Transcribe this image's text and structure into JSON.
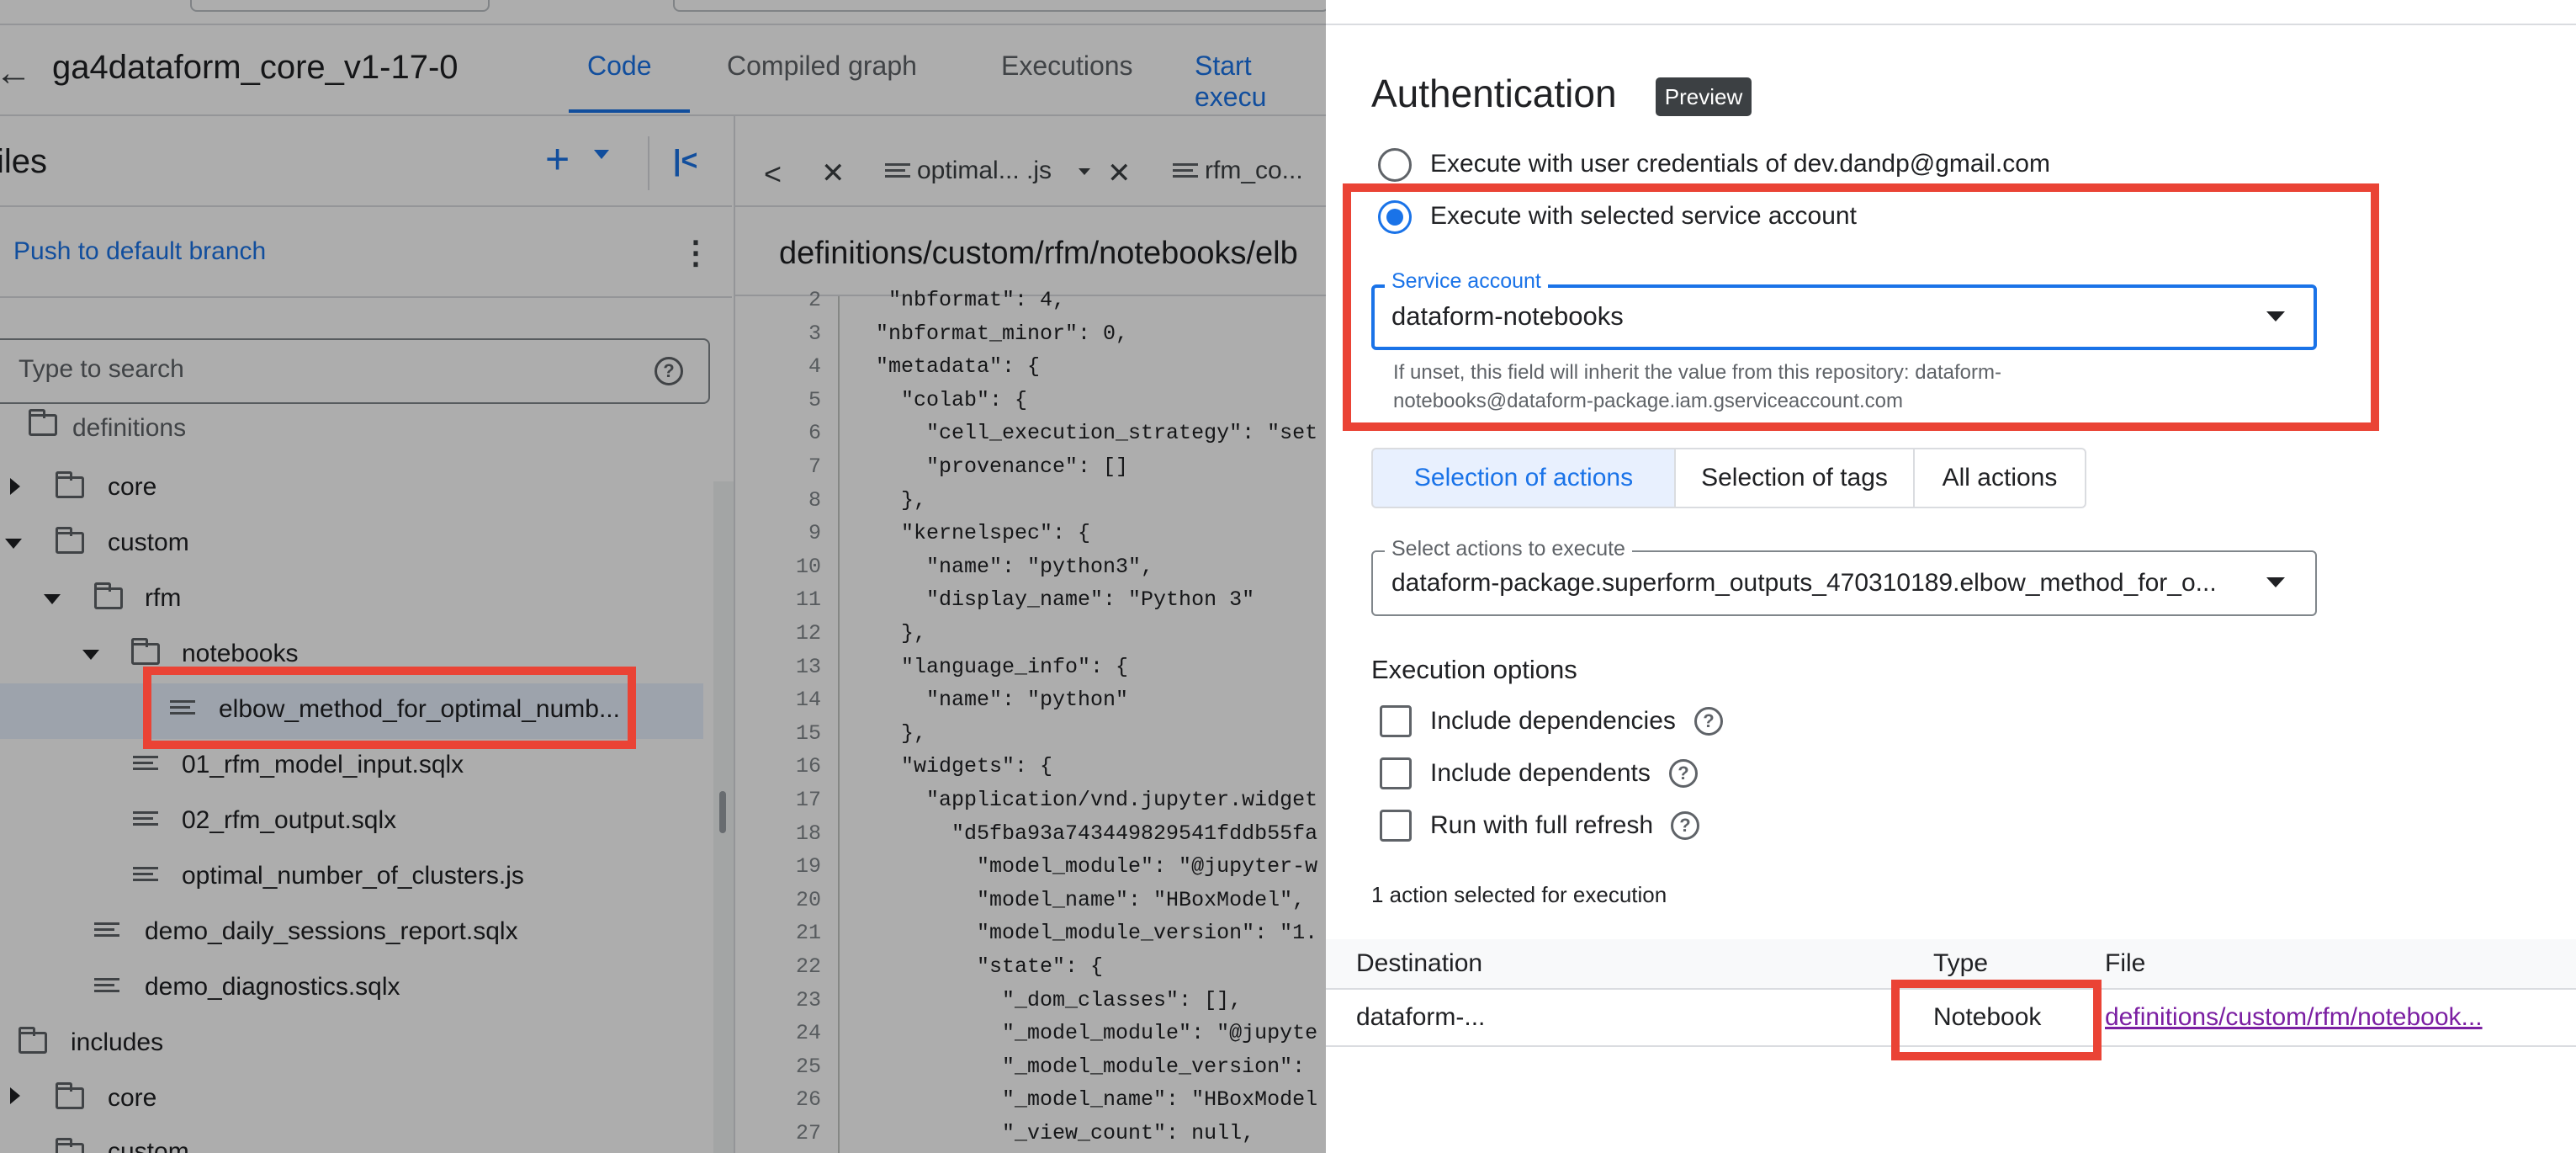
{
  "ide": {
    "workspace_title": "ga4dataform_core_v1-17-0",
    "tabs": [
      {
        "label": "Code",
        "active": true
      },
      {
        "label": "Compiled graph",
        "active": false
      },
      {
        "label": "Executions",
        "active": false
      },
      {
        "label": "Start execu",
        "active": false
      }
    ],
    "files_title": "iles",
    "push_label": "Push to default branch",
    "search_placeholder": "Type to search",
    "tree": [
      {
        "label": "definitions",
        "type": "folder"
      },
      {
        "label": "core",
        "type": "folder",
        "expanded": false
      },
      {
        "label": "custom",
        "type": "folder",
        "expanded": true
      },
      {
        "label": "rfm",
        "type": "folder",
        "expanded": true
      },
      {
        "label": "notebooks",
        "type": "folder",
        "expanded": true
      },
      {
        "label": "elbow_method_for_optimal_numb...",
        "type": "file",
        "selected": true
      },
      {
        "label": "01_rfm_model_input.sqlx",
        "type": "file"
      },
      {
        "label": "02_rfm_output.sqlx",
        "type": "file"
      },
      {
        "label": "optimal_number_of_clusters.js",
        "type": "file"
      },
      {
        "label": "demo_daily_sessions_report.sqlx",
        "type": "file"
      },
      {
        "label": "demo_diagnostics.sqlx",
        "type": "file"
      },
      {
        "label": "includes",
        "type": "folder"
      },
      {
        "label": "core",
        "type": "folder",
        "expanded": false
      },
      {
        "label": "custom",
        "type": "folder"
      }
    ],
    "editor_tabs": [
      {
        "label": "optimal... .js"
      },
      {
        "label": "rfm_co..."
      }
    ],
    "editor_path": "definitions/custom/rfm/notebooks/elb",
    "code_lines": [
      {
        "n": "2",
        "text": "  \"nbformat\": 4,"
      },
      {
        "n": "3",
        "text": " \"nbformat_minor\": 0,"
      },
      {
        "n": "4",
        "text": " \"metadata\": {"
      },
      {
        "n": "5",
        "text": "   \"colab\": {"
      },
      {
        "n": "6",
        "text": "     \"cell_execution_strategy\": \"set"
      },
      {
        "n": "7",
        "text": "     \"provenance\": []"
      },
      {
        "n": "8",
        "text": "   },"
      },
      {
        "n": "9",
        "text": "   \"kernelspec\": {"
      },
      {
        "n": "10",
        "text": "     \"name\": \"python3\","
      },
      {
        "n": "11",
        "text": "     \"display_name\": \"Python 3\""
      },
      {
        "n": "12",
        "text": "   },"
      },
      {
        "n": "13",
        "text": "   \"language_info\": {"
      },
      {
        "n": "14",
        "text": "     \"name\": \"python\""
      },
      {
        "n": "15",
        "text": "   },"
      },
      {
        "n": "16",
        "text": "   \"widgets\": {"
      },
      {
        "n": "17",
        "text": "     \"application/vnd.jupyter.widget"
      },
      {
        "n": "18",
        "text": "       \"d5fba93a743449829541fddb55fa"
      },
      {
        "n": "19",
        "text": "         \"model_module\": \"@jupyter-w"
      },
      {
        "n": "20",
        "text": "         \"model_name\": \"HBoxModel\","
      },
      {
        "n": "21",
        "text": "         \"model_module_version\": \"1."
      },
      {
        "n": "22",
        "text": "         \"state\": {"
      },
      {
        "n": "23",
        "text": "           \"_dom_classes\": [],"
      },
      {
        "n": "24",
        "text": "           \"_model_module\": \"@jupyte"
      },
      {
        "n": "25",
        "text": "           \"_model_module_version\":"
      },
      {
        "n": "26",
        "text": "           \"_model_name\": \"HBoxModel"
      },
      {
        "n": "27",
        "text": "           \"_view_count\": null,"
      }
    ]
  },
  "panel": {
    "title": "Authentication",
    "badge": "Preview",
    "radio_user": "Execute with user credentials of dev.dandp@gmail.com",
    "radio_service": "Execute with selected service account",
    "service_account_label": "Service account",
    "service_account_value": "dataform-notebooks",
    "service_account_hint": "If unset, this field will inherit the value from this repository: dataform-notebooks@dataform-package.iam.gserviceaccount.com",
    "segments": [
      {
        "label": "Selection of actions",
        "active": true
      },
      {
        "label": "Selection of tags",
        "active": false
      },
      {
        "label": "All actions",
        "active": false
      }
    ],
    "select_actions_label": "Select actions to execute",
    "select_actions_value": "dataform-package.superform_outputs_470310189.elbow_method_for_o...",
    "execution_options_title": "Execution options",
    "options": [
      {
        "label": "Include dependencies",
        "checked": false
      },
      {
        "label": "Include dependents",
        "checked": false
      },
      {
        "label": "Run with full refresh",
        "checked": false
      }
    ],
    "selected_count": "1 action selected for execution",
    "table": {
      "headers": [
        "Destination",
        "Type",
        "File"
      ],
      "row": {
        "destination": "dataform-...",
        "type": "Notebook",
        "file": "definitions/custom/rfm/notebook..."
      }
    }
  },
  "colors": {
    "accent": "#1a73e8",
    "highlight": "#ea4335",
    "link_visited": "#7b1fa2"
  }
}
